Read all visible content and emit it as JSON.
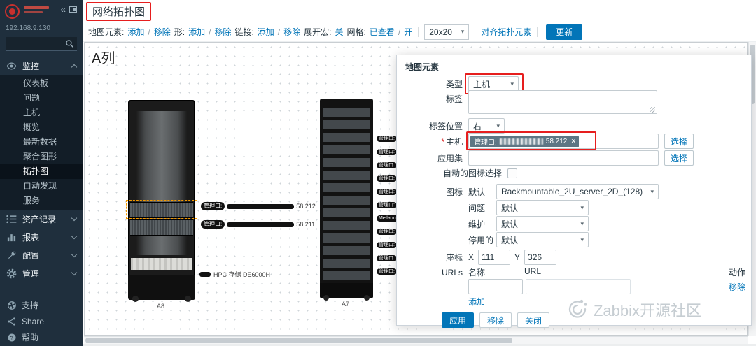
{
  "sidebar": {
    "ip": "192.168.9.130",
    "menu": {
      "monitoring": {
        "label": "监控",
        "items": [
          "仪表板",
          "问题",
          "主机",
          "概览",
          "最新数据",
          "聚合图形",
          "拓扑图",
          "自动发现",
          "服务"
        ],
        "active_item": "拓扑图"
      },
      "inventory": {
        "label": "资产记录"
      },
      "reports": {
        "label": "报表"
      },
      "configuration": {
        "label": "配置"
      },
      "administration": {
        "label": "管理"
      }
    },
    "footer": {
      "support": "支持",
      "share": "Share",
      "help": "帮助"
    }
  },
  "page": {
    "title": "网络拓扑图"
  },
  "toolbar": {
    "map_element_label": "地图元素:",
    "add_link": "添加",
    "sep": "/",
    "remove_link": "移除",
    "shape_label": "形:",
    "link_label": "链接:",
    "expand_macros_label": "展开宏:",
    "expand_macros_value": "关",
    "grid_label": "网格:",
    "grid_state": "已查看",
    "grid_toggle": "开",
    "grid_size": "20x20",
    "align_link": "对齐拓扑元素",
    "update_button": "更新"
  },
  "canvas": {
    "column_label": "A列",
    "left_rack": {
      "name": "A8",
      "hosts": [
        {
          "label": "管理口:",
          "ip": "58.212"
        },
        {
          "label": "管理口:",
          "ip": "58.211"
        }
      ],
      "storage_label": "HPC 存储 DE6000H"
    },
    "right_rack": {
      "name": "A7",
      "rows": [
        "管理口:",
        "管理口:",
        "管理口:",
        "管理口:",
        "管理口:",
        "管理口:",
        "Mellanox",
        "管理口:",
        "管理口:",
        "管理口:",
        "管理口:"
      ]
    }
  },
  "dialog": {
    "title": "地图元素",
    "type_label": "类型",
    "type_value": "主机",
    "label_label": "标签",
    "label_position_label": "标签位置",
    "label_position_value": "右",
    "required_mark": "*",
    "host_label": "主机",
    "host_chip": {
      "prefix": "管理口:",
      "suffix": "58.212",
      "close": "×"
    },
    "select_button": "选择",
    "application_label": "应用集",
    "auto_icon_label": "自动的图标选择",
    "icons_label": "图标",
    "icon_rows": [
      {
        "label": "默认",
        "value": "Rackmountable_2U_server_2D_(128)"
      },
      {
        "label": "问题",
        "value": "默认"
      },
      {
        "label": "维护",
        "value": "默认"
      },
      {
        "label": "停用的",
        "value": "默认"
      }
    ],
    "coords_label": "座标",
    "x_label": "X",
    "x_value": "111",
    "y_label": "Y",
    "y_value": "326",
    "urls_label": "URLs",
    "urls_headers": {
      "name": "名称",
      "url": "URL",
      "action": "动作"
    },
    "url_remove_link": "移除",
    "url_add_link": "添加",
    "buttons": {
      "apply": "应用",
      "remove": "移除",
      "close": "关闭"
    }
  },
  "watermark": {
    "text": "Zabbix开源社区"
  },
  "colors": {
    "accent": "#0275b8",
    "annotation": "#e61e1e",
    "chip_bg": "#5d7684",
    "sidebar_bg": "#1f2f3d"
  }
}
